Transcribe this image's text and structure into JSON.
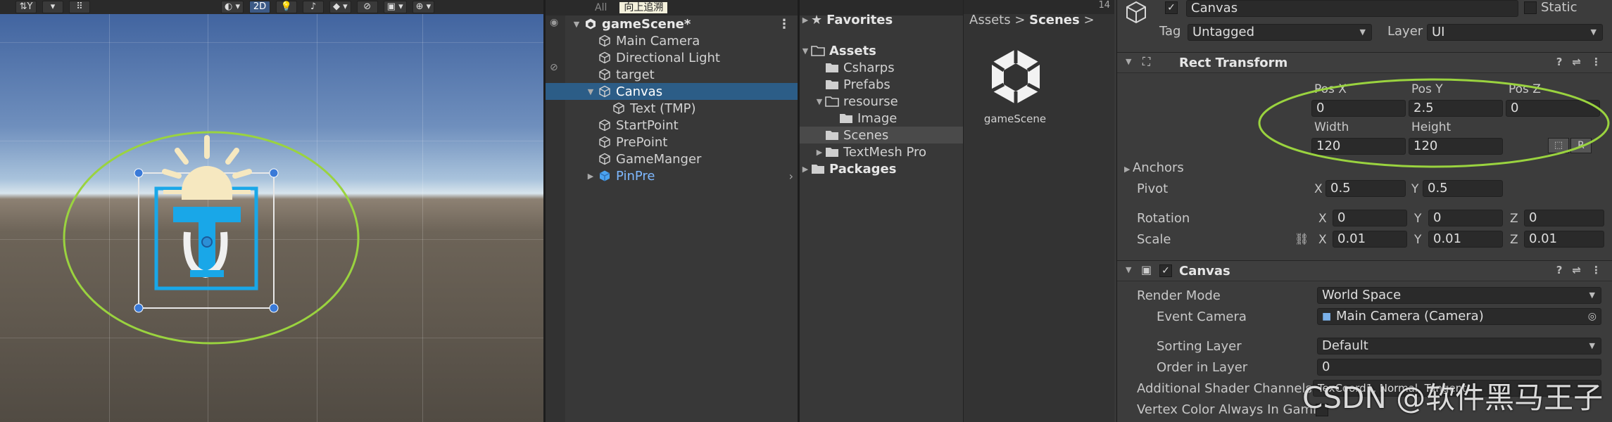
{
  "scene": {
    "toolbar": {
      "pivot_label": "⇅Y",
      "mode_2d": "2D"
    },
    "highlight_color": "#9ad33f"
  },
  "hierarchy": {
    "tooltip": "向上追溯",
    "search_placeholder": "All",
    "items": [
      {
        "label": "gameScene*",
        "level": 0,
        "expanded": true,
        "bold": true,
        "icon": "unity-scene-icon"
      },
      {
        "label": "Main Camera",
        "level": 1,
        "icon": "gameobject-cube-icon"
      },
      {
        "label": "Directional Light",
        "level": 1,
        "icon": "gameobject-cube-icon"
      },
      {
        "label": "target",
        "level": 1,
        "icon": "gameobject-cube-icon"
      },
      {
        "label": "Canvas",
        "level": 1,
        "expanded": true,
        "selected": true,
        "icon": "gameobject-cube-icon"
      },
      {
        "label": "Text (TMP)",
        "level": 2,
        "icon": "gameobject-cube-icon"
      },
      {
        "label": "StartPoint",
        "level": 1,
        "icon": "gameobject-cube-icon"
      },
      {
        "label": "PrePoint",
        "level": 1,
        "icon": "gameobject-cube-icon"
      },
      {
        "label": "GameManger",
        "level": 1,
        "icon": "gameobject-cube-icon"
      },
      {
        "label": "PinPre",
        "level": 1,
        "collapsed": true,
        "prefab": true,
        "icon": "prefab-cube-icon"
      }
    ]
  },
  "project": {
    "favorites": "Favorites",
    "assets": "Assets",
    "folders": [
      {
        "label": "Csharps",
        "level": 1
      },
      {
        "label": "Prefabs",
        "level": 1
      },
      {
        "label": "resourse",
        "level": 1,
        "expanded": true
      },
      {
        "label": "Image",
        "level": 2
      },
      {
        "label": "Scenes",
        "level": 1,
        "selected": true
      },
      {
        "label": "TextMesh Pro",
        "level": 1,
        "collapsed": true
      }
    ],
    "packages": "Packages",
    "breadcrumb": {
      "root": "Assets",
      "current": "Scenes"
    },
    "asset_item": "gameScene",
    "count_badge": "14"
  },
  "inspector": {
    "name": "Canvas",
    "static_label": "Static",
    "tag_label": "Tag",
    "tag_value": "Untagged",
    "layer_label": "Layer",
    "layer_value": "UI",
    "rect_transform": {
      "title": "Rect Transform",
      "pos_x_label": "Pos X",
      "pos_x": "0",
      "pos_y_label": "Pos Y",
      "pos_y": "2.5",
      "pos_z_label": "Pos Z",
      "pos_z": "0",
      "width_label": "Width",
      "width": "120",
      "height_label": "Height",
      "height": "120",
      "raw_edit": "R",
      "anchors_label": "Anchors",
      "pivot_label": "Pivot",
      "pivot_x": "0.5",
      "pivot_y": "0.5",
      "rotation_label": "Rotation",
      "rot_x": "0",
      "rot_y": "0",
      "rot_z": "0",
      "scale_label": "Scale",
      "scale_x": "0.01",
      "scale_y": "0.01",
      "scale_z": "0.01",
      "x": "X",
      "y": "Y",
      "z": "Z"
    },
    "canvas": {
      "title": "Canvas",
      "render_mode_label": "Render Mode",
      "render_mode": "World Space",
      "event_camera_label": "Event Camera",
      "event_camera": "Main Camera (Camera)",
      "sorting_layer_label": "Sorting Layer",
      "sorting_layer": "Default",
      "order_label": "Order in Layer",
      "order": "0",
      "shader_channels_label": "Additional Shader Channels",
      "shader_channels": "TexCoord1, Normal, Tangent",
      "vertex_color_label": "Vertex Color Always In Gamm"
    }
  },
  "watermark": "CSDN @软件黑马王子"
}
